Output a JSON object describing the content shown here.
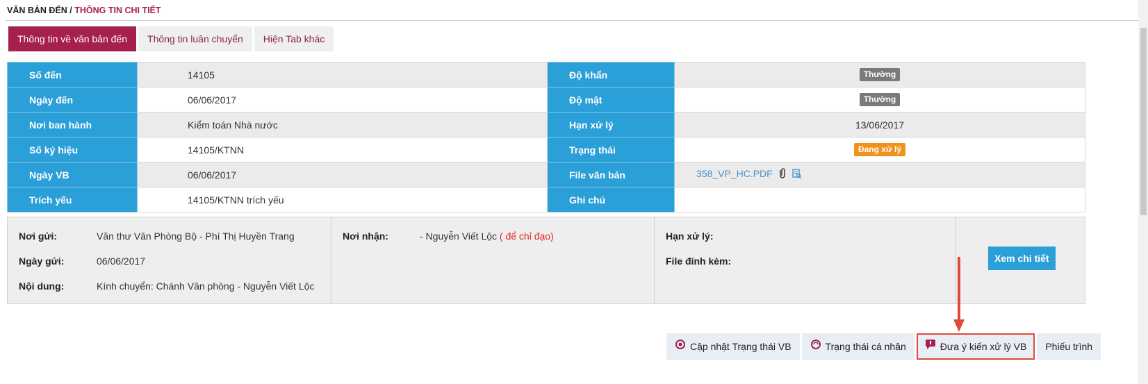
{
  "breadcrumb": {
    "root": "VĂN BẢN ĐẾN",
    "sep": " / ",
    "current": "THÔNG TIN CHI TIẾT"
  },
  "tabs": [
    {
      "label": "Thông tin về văn bản đến",
      "active": true
    },
    {
      "label": "Thông tin luân chuyển",
      "active": false
    },
    {
      "label": "Hiện Tab khác",
      "active": false
    }
  ],
  "info": {
    "rows": [
      {
        "l1": "Số đến",
        "v1": "14105",
        "l2": "Độ khẩn",
        "v2": "Thường",
        "v2_type": "badge-gray"
      },
      {
        "l1": "Ngày đến",
        "v1": "06/06/2017",
        "l2": "Độ mật",
        "v2": "Thường",
        "v2_type": "badge-gray"
      },
      {
        "l1": "Nơi ban hành",
        "v1": "Kiểm toán Nhà nước",
        "l2": "Hạn xử lý",
        "v2": "13/06/2017",
        "v2_type": "text"
      },
      {
        "l1": "Số ký hiệu",
        "v1": "14105/KTNN",
        "l2": "Trạng thái",
        "v2": "Đang xử lý",
        "v2_type": "badge-orange"
      },
      {
        "l1": "Ngày VB",
        "v1": "06/06/2017",
        "l2": "File văn bản",
        "v2": "358_VP_HC.PDF",
        "v2_type": "file"
      },
      {
        "l1": "Trích yếu",
        "v1": "14105/KTNN trích yếu",
        "l2": "Ghi chú",
        "v2": "",
        "v2_type": "text"
      }
    ],
    "file_icons": [
      "attachment-icon",
      "document-view-icon"
    ]
  },
  "transfer": {
    "sender_label": "Nơi gửi:",
    "sender": "Văn thư Văn Phòng Bộ - Phí Thị Huyền Trang",
    "date_label": "Ngày gửi:",
    "date": "06/06/2017",
    "content_label": "Nội dung:",
    "content": "Kính chuyển: Chánh Văn phòng - Nguyễn Viết Lộc",
    "receiver_label": "Nơi nhận:",
    "receiver": "- Nguyễn Viết Lộc",
    "receiver_note": "( để chỉ đạo)",
    "deadline_label": "Hạn xử lý:",
    "attach_label": "File đính kèm:",
    "detail_button": "Xem chi tiết"
  },
  "actions": [
    {
      "label": "Cập nhật Trạng thái VB",
      "icon": "status-update-icon"
    },
    {
      "label": "Trạng thái cá nhân",
      "icon": "personal-status-icon"
    },
    {
      "label": "Đưa ý kiến xử lý VB",
      "icon": "comment-icon",
      "highlighted": true
    },
    {
      "label": "Phiếu trình",
      "icon": ""
    }
  ],
  "colors": {
    "accent": "#a51f4f",
    "header_blue": "#2a9fd8",
    "orange": "#f0931e",
    "highlight": "#e04a3a"
  }
}
